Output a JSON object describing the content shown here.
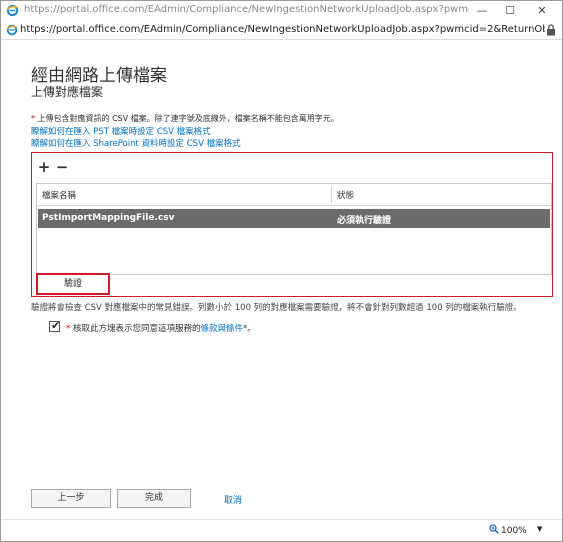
{
  "browser": {
    "window_title": "https://portal.office.com/EAdmin/Compliance/NewIngestionNetworkUploadJob.aspx?pwmcid=2&Re...",
    "address": "https://portal.office.com/EAdmin/Compliance/NewIngestionNetworkUploadJob.aspx?pwmcid=2&ReturnObjectType=1",
    "min_glyph": "—",
    "max_glyph": "☐",
    "close_glyph": "✕",
    "zoom": "100%",
    "zoom_caret": "▼"
  },
  "page": {
    "title": "經由網路上傳檔案",
    "subtitle": "上傳對應檔案",
    "note_star": "*",
    "note_text": " 上傳包含對應資訊的 CSV 檔案。除了連字號及底線外，檔案名稱不能包含萬用字元。",
    "link_pst": "瞭解如何在匯入 PST 檔案時設定 CSV 檔案格式",
    "link_sharepoint": "瞭解如何在匯入 SharePoint 資料時設定 CSV 檔案格式",
    "add_glyph": "+",
    "remove_glyph": "−",
    "table": {
      "col_file": "檔案名稱",
      "col_status": "狀態",
      "rows": [
        {
          "file": "PstImportMappingFile.csv",
          "status": "必須執行驗證"
        }
      ]
    },
    "verify_button": "驗證",
    "verify_note": "驗證將會檢查 CSV 對應檔案中的常見錯誤。列數小於 100 列的對應檔案需要驗證，將不會針對列數超過 100 列的檔案執行驗證。",
    "agree_check": "✔",
    "agree_star": "*",
    "agree_prefix": " 核取此方塊表示您同意這項服務的",
    "agree_link": "條款與條件",
    "agree_suffix": "*。",
    "back_button": "上一步",
    "finish_button": "完成",
    "cancel_link": "取消"
  }
}
